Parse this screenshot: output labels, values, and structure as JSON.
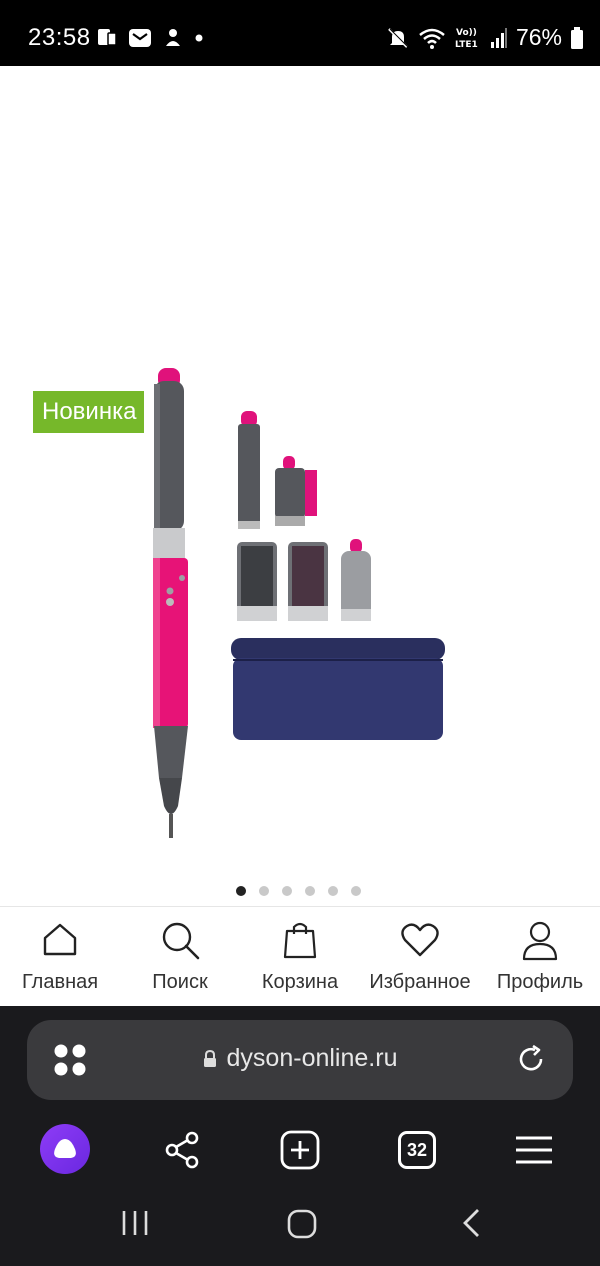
{
  "status_bar": {
    "time": "23:58",
    "battery": "76%",
    "icons_left": [
      "notification-icon",
      "mail-icon",
      "app-icon",
      "dot-icon"
    ],
    "icons_right": [
      "mute-icon",
      "wifi-icon",
      "volte-lte-icon",
      "signal-icon",
      "battery-icon"
    ],
    "network_label": "Vo)) LTE1"
  },
  "product": {
    "badge": "Новинка",
    "badge_color": "#76b82a",
    "image_name": "dyson-airwrap-fuchsia-set",
    "carousel": {
      "count": 6,
      "active": 0
    }
  },
  "bottom_nav": {
    "items": [
      {
        "label": "Главная",
        "icon": "home-icon"
      },
      {
        "label": "Поиск",
        "icon": "search-icon"
      },
      {
        "label": "Корзина",
        "icon": "bag-icon"
      },
      {
        "label": "Избранное",
        "icon": "heart-icon"
      },
      {
        "label": "Профиль",
        "icon": "user-icon"
      }
    ]
  },
  "browser": {
    "url": "dyson-online.ru",
    "tabs_count": "32",
    "accent": "#7b35f0"
  }
}
